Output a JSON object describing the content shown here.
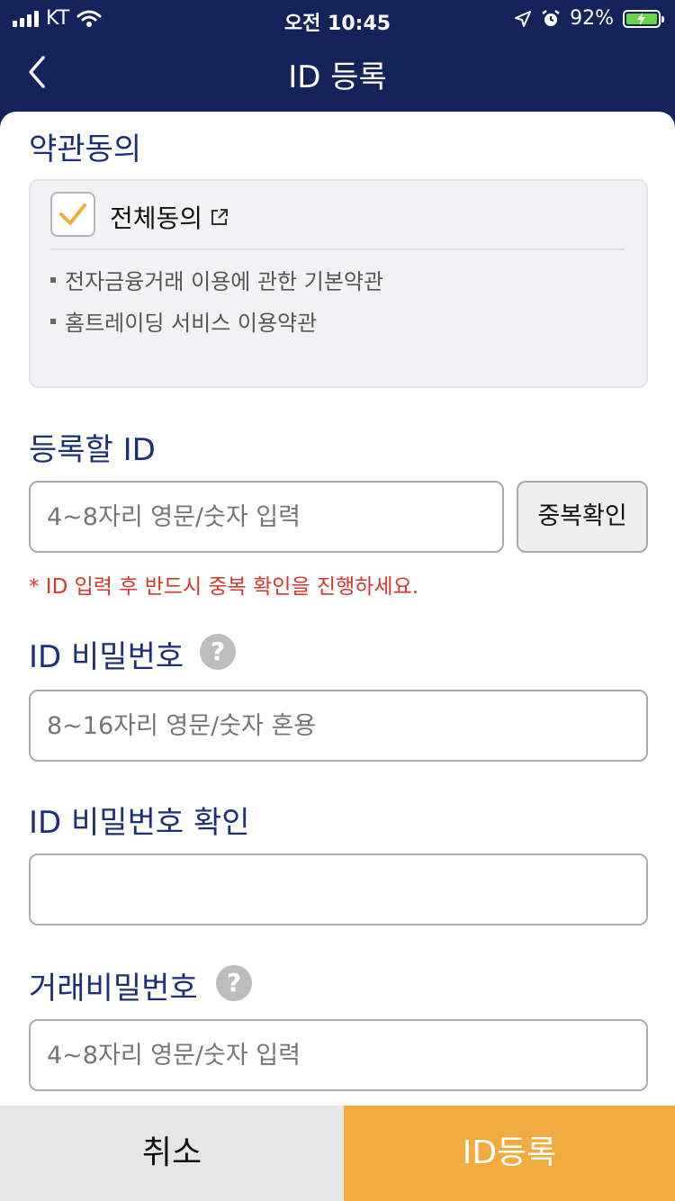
{
  "status_bar": {
    "carrier": "KT",
    "time": "오전 10:45",
    "battery": "92%"
  },
  "nav": {
    "title": "ID 등록"
  },
  "terms": {
    "section_title": "약관동의",
    "agree_all_label": "전체동의",
    "agree_all_checked": true,
    "items": [
      "전자금융거래 이용에 관한 기본약관",
      "홈트레이딩 서비스 이용약관"
    ]
  },
  "id_field": {
    "label": "등록할 ID",
    "placeholder": "4~8자리 영문/숫자 입력",
    "check_button": "중복확인",
    "warning": "* ID 입력 후 반드시 중복 확인을 진행하세요."
  },
  "password_field": {
    "label": "ID 비밀번호",
    "placeholder": "8~16자리 영문/숫자 혼용",
    "help": "?"
  },
  "password_confirm_field": {
    "label": "ID 비밀번호 확인",
    "placeholder": ""
  },
  "trade_password_field": {
    "label": "거래비밀번호",
    "placeholder": "4~8자리 영문/숫자 입력",
    "help": "?"
  },
  "actions": {
    "cancel": "취소",
    "submit": "ID등록"
  },
  "colors": {
    "navy": "#14245a",
    "accent": "#f0ac40",
    "warning": "#d7362c",
    "title_blue": "#1c2f78"
  },
  "icons": [
    "signal-icon",
    "wifi-icon",
    "location-arrow-icon",
    "alarm-icon",
    "battery-icon",
    "back-chevron-icon",
    "checkmark-icon",
    "external-link-icon",
    "help-icon"
  ]
}
